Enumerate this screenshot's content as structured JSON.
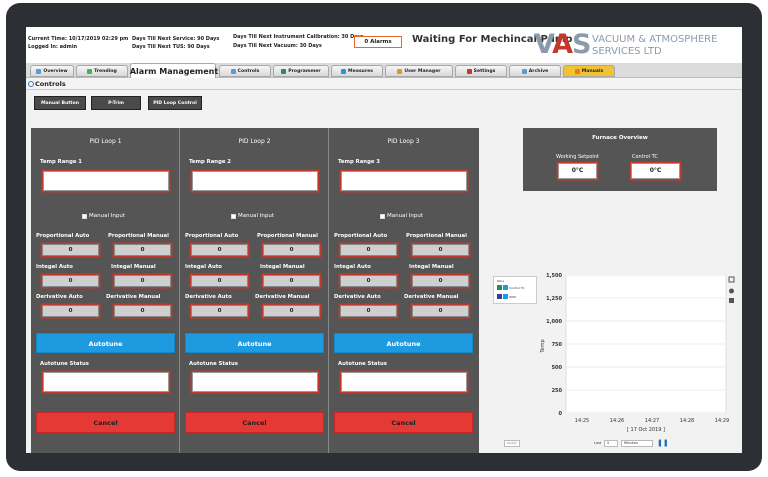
{
  "header": {
    "current_time": "Current Time: 10/17/2019 02:29 pm",
    "logged_in": "Logged In: admin",
    "service": "Days Till Next Service: 90 Days",
    "tus": "Days Till Next TUS: 90 Days",
    "calibration": "Days Till Next Instrument Calibration: 30 Days",
    "vacuum": "Days Till Next Vacuum: 30 Days",
    "alarms": "0 Alarms",
    "status": "Waiting For Mechincal Pump"
  },
  "logo": {
    "mark_v": "V",
    "mark_a": "A",
    "mark_s": "S",
    "line1": "VACUUM & ATMOSPHERE",
    "line2": "SERVICES LTD"
  },
  "tabs": [
    {
      "label": "Overview",
      "icon": "overview-icon"
    },
    {
      "label": "Trending",
      "icon": "trending-icon"
    },
    {
      "label": "Alarm Management",
      "icon": "warning-icon"
    },
    {
      "label": "Controls",
      "icon": "controls-icon"
    },
    {
      "label": "Programmer",
      "icon": "programmer-icon"
    },
    {
      "label": "Measures",
      "icon": "measures-icon"
    },
    {
      "label": "User Manager",
      "icon": "user-icon"
    },
    {
      "label": "Settings",
      "icon": "settings-icon"
    },
    {
      "label": "Archive",
      "icon": "archive-icon"
    },
    {
      "label": "Manuals",
      "icon": "manuals-icon"
    }
  ],
  "breadcrumb": "Controls",
  "subbuttons": [
    "Manual Button",
    "P-Trim",
    "PID Loop Control"
  ],
  "loops": [
    {
      "title": "PID Loop 1",
      "temp_range": "Temp Range 1"
    },
    {
      "title": "PID Loop  2",
      "temp_range": "Temp Range 2"
    },
    {
      "title": "PID Loop 3",
      "temp_range": "Temp Range 3"
    }
  ],
  "loop_labels": {
    "manual_input": "Manual Input",
    "prop_auto": "Proportional Auto",
    "prop_manual": "Proportional Manual",
    "int_auto": "Integal Auto",
    "int_manual": "Integal Manual",
    "der_auto": "Derivative Auto",
    "der_manual": "Derivative Manual",
    "zero": "0",
    "autotune": "Autotune",
    "autotune_status": "Autotune Status",
    "cancel": "Cancel"
  },
  "furnace": {
    "title": "Furnace Overview",
    "setpoint_label": "Working Setpoint",
    "setpoint_value": "0°C",
    "tc_label": "Control TC",
    "tc_value": "0°C"
  },
  "legend": {
    "title": "Pens",
    "items": [
      "Control TC",
      "WSP"
    ],
    "colors": [
      "#2e8b57",
      "#3a3aa0"
    ]
  },
  "chart_data": {
    "type": "line",
    "ylabel": "Temp",
    "yticks": [
      "1,500",
      "1,250",
      "1,000",
      "750",
      "500",
      "250",
      "0"
    ],
    "xticks": [
      "14:25",
      "14:26",
      "14:27",
      "14:28",
      "14:29"
    ],
    "date": "[ 17 Oct 2019 ]",
    "ylim": [
      0,
      1500
    ],
    "series": []
  },
  "chart_controls": {
    "apply": "Apply",
    "last": "Last",
    "count": "5",
    "unit": "Minutes"
  }
}
